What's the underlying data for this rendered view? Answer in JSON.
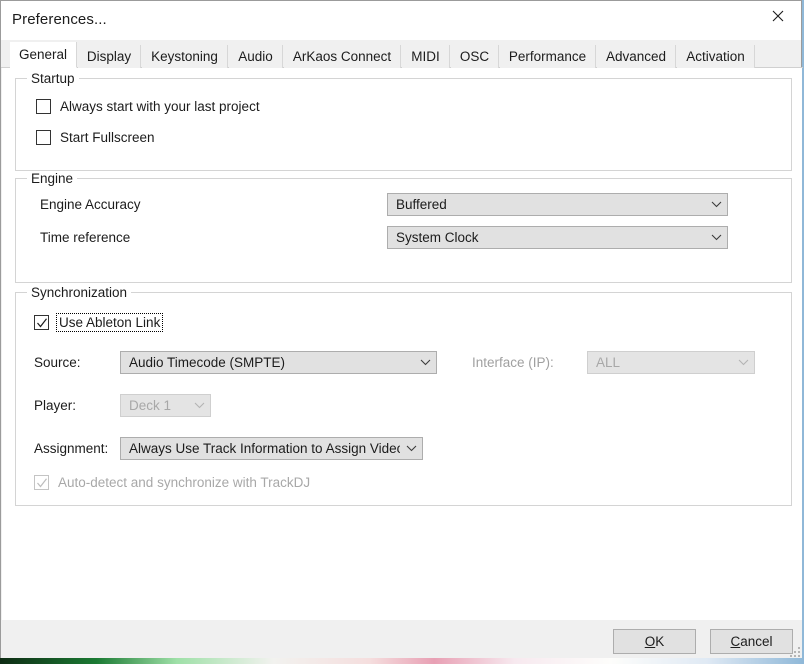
{
  "window": {
    "title": "Preferences...",
    "close_icon": "close-icon"
  },
  "tabs": [
    {
      "label": "General",
      "active": true
    },
    {
      "label": "Display",
      "active": false
    },
    {
      "label": "Keystoning",
      "active": false
    },
    {
      "label": "Audio",
      "active": false
    },
    {
      "label": "ArKaos Connect",
      "active": false
    },
    {
      "label": "MIDI",
      "active": false
    },
    {
      "label": "OSC",
      "active": false
    },
    {
      "label": "Performance",
      "active": false
    },
    {
      "label": "Advanced",
      "active": false
    },
    {
      "label": "Activation",
      "active": false
    }
  ],
  "startup": {
    "group_title": "Startup",
    "always_start_label": "Always start with your last project",
    "always_start_checked": false,
    "start_fullscreen_label": "Start Fullscreen",
    "start_fullscreen_checked": false
  },
  "engine": {
    "group_title": "Engine",
    "accuracy_label": "Engine Accuracy",
    "accuracy_value": "Buffered",
    "time_reference_label": "Time reference",
    "time_reference_value": "System Clock"
  },
  "synchronization": {
    "group_title": "Synchronization",
    "ableton_link_label": "Use Ableton Link",
    "ableton_link_checked": true,
    "source_label": "Source:",
    "source_value": "Audio Timecode (SMPTE)",
    "interface_label": "Interface (IP):",
    "interface_value": "ALL",
    "interface_enabled": false,
    "player_label": "Player:",
    "player_value": "Deck 1",
    "player_enabled": false,
    "assignment_label": "Assignment:",
    "assignment_value": "Always Use Track Information to Assign Video Loop",
    "autodetect_label": "Auto-detect and synchronize with TrackDJ",
    "autodetect_checked": true,
    "autodetect_enabled": false
  },
  "footer": {
    "ok_accel": "O",
    "ok_rest": "K",
    "cancel_accel": "C",
    "cancel_rest": "ancel"
  },
  "colors": {
    "dialog_bg": "#f0f0f0",
    "page_bg": "#ffffff",
    "text": "#1c1c1c",
    "disabled_text": "#a8a8a8",
    "control_bg": "#e1e1e1",
    "control_border": "#adadad",
    "group_border": "#d4d4d4"
  }
}
